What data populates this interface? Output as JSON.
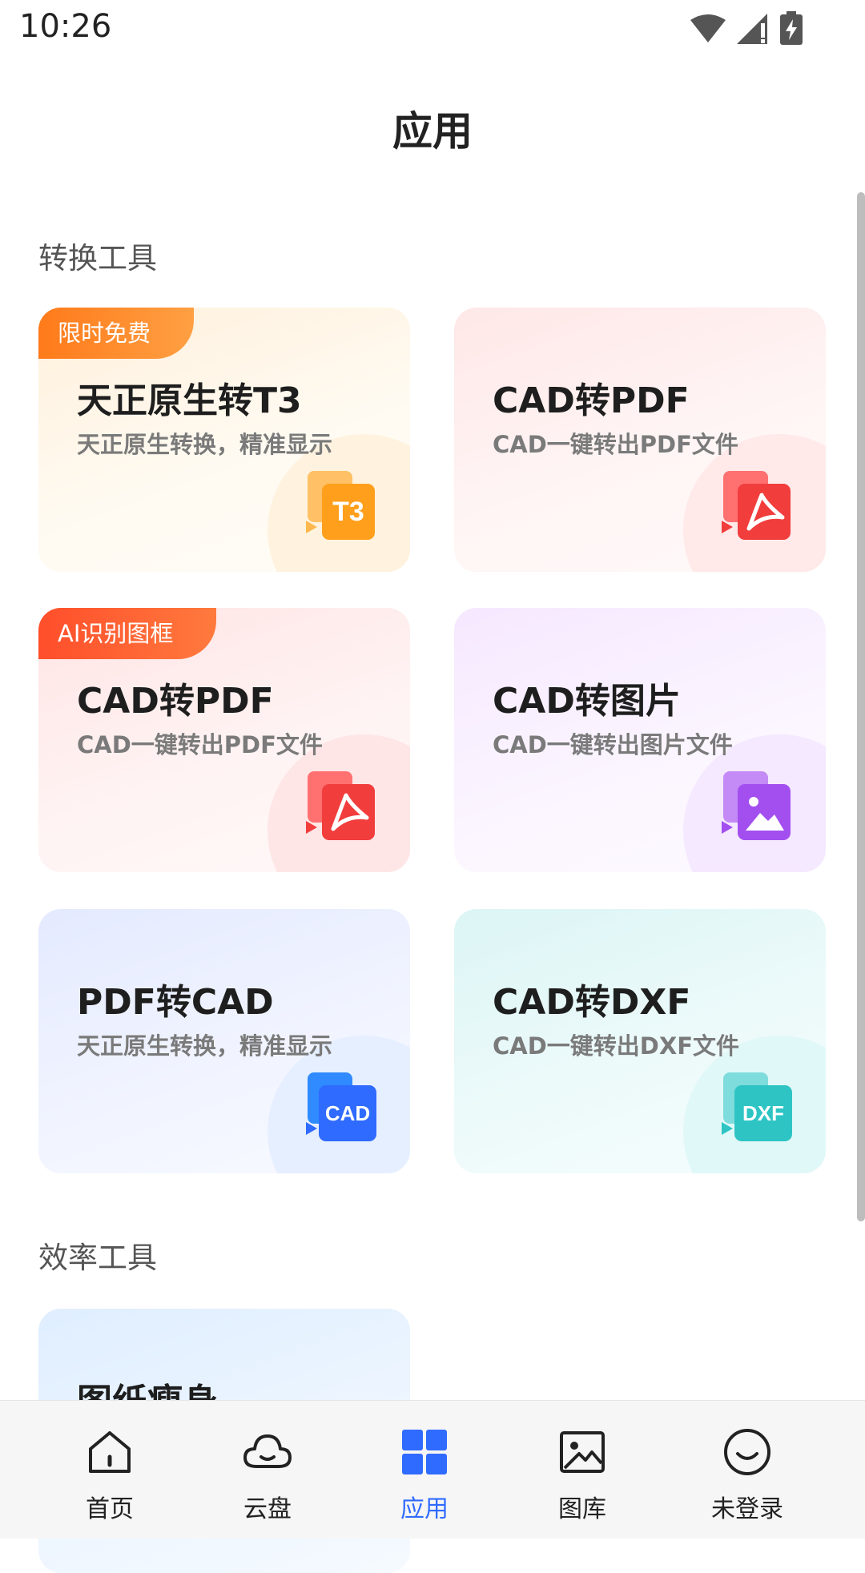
{
  "status_bar": {
    "time": "10:26"
  },
  "page": {
    "title": "应用"
  },
  "sections": [
    {
      "title": "转换工具"
    },
    {
      "title": "效率工具"
    }
  ],
  "cards": [
    {
      "title": "天正原生转T3",
      "subtitle": "天正原生转换，精准显示",
      "badge": "限时免费",
      "icon": "t3-file-icon",
      "icon_text": "T3",
      "accent": "#ff9f1c"
    },
    {
      "title": "CAD转PDF",
      "subtitle": "CAD一键转出PDF文件",
      "badge": "",
      "icon": "pdf-file-icon",
      "accent": "#f23d3d"
    },
    {
      "title": "CAD转PDF",
      "subtitle": "CAD一键转出PDF文件",
      "badge": "AI识别图框",
      "icon": "pdf-file-icon",
      "accent": "#f23d3d"
    },
    {
      "title": "CAD转图片",
      "subtitle": "CAD一键转出图片文件",
      "badge": "",
      "icon": "image-file-icon",
      "accent": "#a34ff0"
    },
    {
      "title": "PDF转CAD",
      "subtitle": "天正原生转换，精准显示",
      "badge": "",
      "icon": "cad-file-icon",
      "icon_text": "CAD",
      "accent": "#2f6bff"
    },
    {
      "title": "CAD转DXF",
      "subtitle": "CAD一键转出DXF文件",
      "badge": "",
      "icon": "dxf-file-icon",
      "icon_text": "DXF",
      "accent": "#2ec4c4"
    },
    {
      "title": "图纸瘦身",
      "subtitle": "",
      "badge": "",
      "icon": ""
    }
  ],
  "bottom_nav": [
    {
      "label": "首页",
      "icon": "home-icon",
      "active": false
    },
    {
      "label": "云盘",
      "icon": "cloud-icon",
      "active": false
    },
    {
      "label": "应用",
      "icon": "apps-grid-icon",
      "active": true
    },
    {
      "label": "图库",
      "icon": "gallery-icon",
      "active": false
    },
    {
      "label": "未登录",
      "icon": "user-face-icon",
      "active": false
    }
  ],
  "colors": {
    "accent": "#2f6bff",
    "badge_orange": "#ff8c33",
    "badge_red": "#ff5a2e"
  }
}
